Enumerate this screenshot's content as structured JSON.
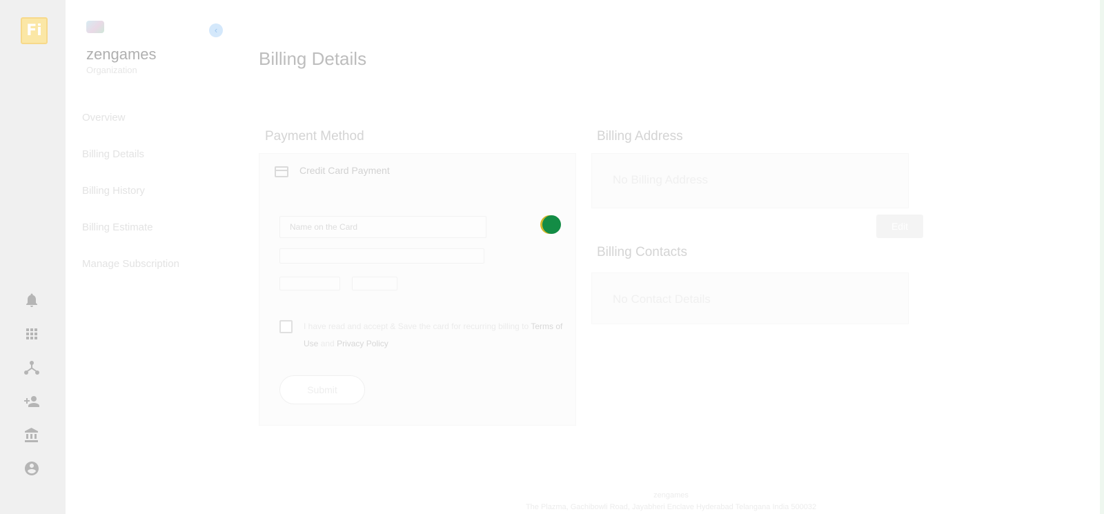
{
  "rail": {
    "logo_text": "Fi",
    "icons": [
      "bell-icon",
      "apps-grid-icon",
      "hierarchy-icon",
      "add-user-icon",
      "bank-icon",
      "account-circle-icon"
    ]
  },
  "org": {
    "name": "zengames",
    "type": "Organization",
    "collapse_icon": "chevron-left-icon"
  },
  "nav": {
    "items": [
      "Overview",
      "Billing Details",
      "Billing History",
      "Billing Estimate",
      "Manage Subscription"
    ]
  },
  "page": {
    "title": "Billing Details"
  },
  "payment_method": {
    "title": "Payment Method",
    "option_label": "Credit Card Payment",
    "option_icon": "credit-card-icon",
    "name_placeholder": "Name on the Card",
    "terms_prefix": "I have read and accept & Save the card for recurring billing to",
    "terms_link": "Terms of Use",
    "terms_and": "and",
    "privacy_link": "Privacy Policy",
    "submit_label": "Submit"
  },
  "billing_address": {
    "title": "Billing Address",
    "empty_text": "No Billing Address",
    "edit_label": "Edit"
  },
  "billing_contacts": {
    "title": "Billing Contacts",
    "empty_text": "No Contact Details"
  },
  "footer": {
    "company": "zengames",
    "address": "The Plazma, Gachibowli Road, Jayabheri Enclave Hyderabad Telangana India 500032"
  },
  "colors": {
    "spinner": "#138c45",
    "logo": "#fbe7a6",
    "rail": "#f0f0f0"
  }
}
